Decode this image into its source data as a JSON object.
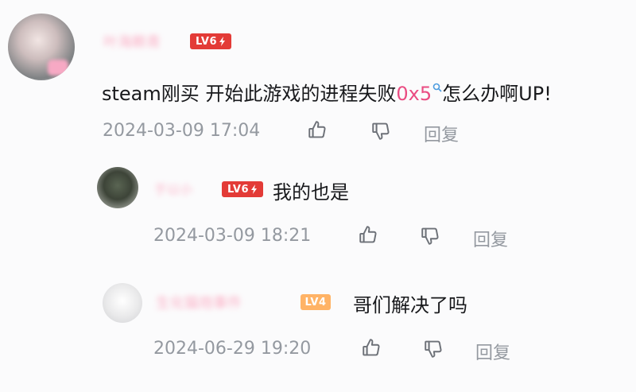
{
  "comments": [
    {
      "username": "叶海赖青",
      "level": "LV6",
      "text_before": "steam刚买 开始此游戏的进程失败",
      "highlight": "0x5",
      "text_after": "怎么办啊UP!",
      "time": "2024-03-09 17:04",
      "reply_label": "回复"
    },
    {
      "username": "于以小",
      "level": "LV6",
      "text": "我的也是",
      "time": "2024-03-09 18:21",
      "reply_label": "回复"
    },
    {
      "username": "生化猫炮事件",
      "level": "LV4",
      "text": "哥们解决了吗",
      "time": "2024-06-29 19:20",
      "reply_label": "回复"
    }
  ],
  "colors": {
    "level_high": "#e33b37",
    "level_mid": "#ffb366",
    "username": "#fb7299",
    "highlight": "#ea4c82",
    "meta": "#9499a0"
  },
  "icons": [
    "like-icon",
    "dislike-icon",
    "search-icon",
    "lightning-icon"
  ]
}
